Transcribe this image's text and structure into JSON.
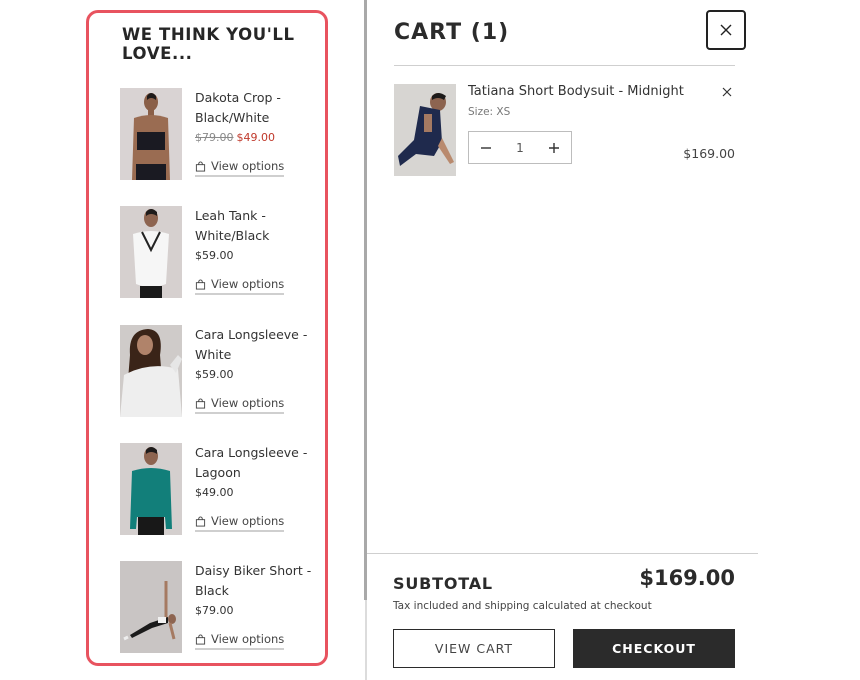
{
  "recommendations": {
    "title": "WE THINK YOU'LL LOVE...",
    "accent_border_color": "#e8535f",
    "view_label": "View options",
    "items": [
      {
        "name": "Dakota Crop - Black/White",
        "price_old": "$79.00",
        "price": "$49.00",
        "on_sale": true
      },
      {
        "name": "Leah Tank - White/Black",
        "price": "$59.00"
      },
      {
        "name": "Cara Longsleeve - White",
        "price": "$59.00"
      },
      {
        "name": "Cara Longsleeve - Lagoon",
        "price": "$49.00"
      },
      {
        "name": "Daisy Biker Short - Black",
        "price": "$79.00"
      }
    ]
  },
  "cart": {
    "title": "CART (1)",
    "close_icon": "close-icon",
    "items": [
      {
        "name": "Tatiana Short Bodysuit - Midnight",
        "size": "Size: XS",
        "quantity": "1",
        "price": "$169.00"
      }
    ],
    "subtotal_label": "SUBTOTAL",
    "subtotal_value": "$169.00",
    "tax_note": "Tax included and shipping calculated at checkout",
    "view_cart_label": "VIEW CART",
    "checkout_label": "CHECKOUT"
  }
}
